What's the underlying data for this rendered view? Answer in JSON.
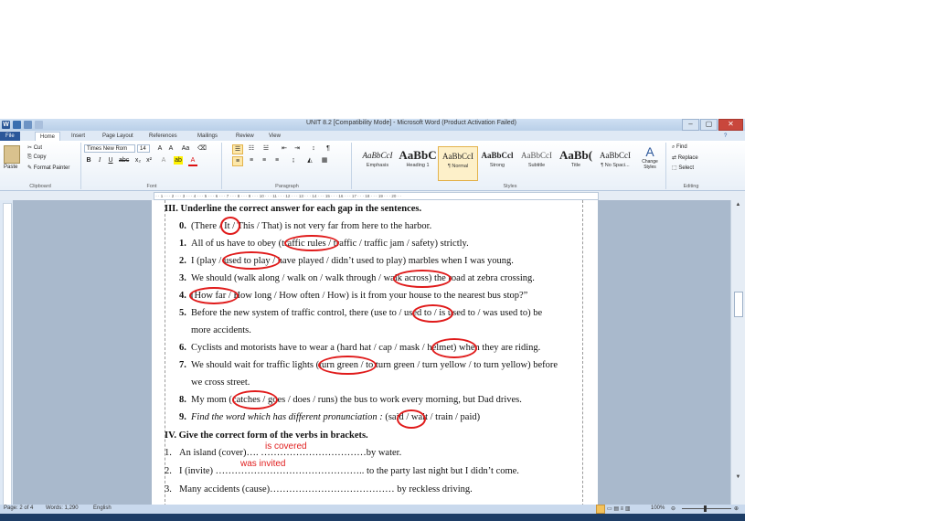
{
  "window": {
    "title": "UNIT 8.2 [Compatibility Mode] - Microsoft Word (Product Activation Failed)",
    "buttons": {
      "minimize": "–",
      "restore": "▢",
      "close": "✕"
    }
  },
  "tabs": [
    "File",
    "Home",
    "Insert",
    "Page Layout",
    "References",
    "Mailings",
    "Review",
    "View"
  ],
  "ribbon": {
    "clipboard": {
      "paste": "Paste",
      "cut": "Cut",
      "copy": "Copy",
      "format_painter": "Format Painter",
      "label": "Clipboard"
    },
    "font": {
      "name": "Times New Rom",
      "size": "14",
      "label": "Font"
    },
    "paragraph": {
      "label": "Paragraph"
    },
    "styles": {
      "label": "Styles",
      "items": [
        {
          "sample": "AaBbCcI",
          "name": "Emphasis"
        },
        {
          "sample": "AaBbC",
          "name": "Heading 1"
        },
        {
          "sample": "AaBbCcI",
          "name": "¶ Normal"
        },
        {
          "sample": "AaBbCcl",
          "name": "Strong"
        },
        {
          "sample": "AaBbCcI",
          "name": "Subtitle"
        },
        {
          "sample": "AaBb(",
          "name": "Title"
        },
        {
          "sample": "AaBbCcI",
          "name": "¶ No Spaci..."
        }
      ],
      "change_styles": "Change Styles"
    },
    "editing": {
      "find": "Find",
      "replace": "Replace",
      "select": "Select",
      "label": "Editing"
    }
  },
  "document": {
    "heading3": "III. Underline the correct answer for each gap in the sentences.",
    "items": [
      {
        "num": "0.",
        "text": "(There / It / This / That) is not very far from here to the harbor."
      },
      {
        "num": "1.",
        "text": "All of us have to obey (traffic rules / traffic / traffic jam / safety) strictly."
      },
      {
        "num": "2.",
        "text": "I (play / used to play / have played / didn’t used to play) marbles when I was young."
      },
      {
        "num": "3.",
        "text": "We should (walk along / walk on / walk through / walk across) the road at zebra crossing."
      },
      {
        "num": "4.",
        "text": "(How far / How long / How often / How) is it from your house to the nearest bus stop?”"
      },
      {
        "num": "5.",
        "text": "Before the new system of traffic control, there (use to / used to / is used to / was used to) be"
      },
      {
        "num": "",
        "text": "more accidents."
      },
      {
        "num": "6.",
        "text": "Cyclists and motorists have to wear a (hard hat / cap / mask / helmet) when they are riding."
      },
      {
        "num": "7.",
        "text": "We should wait for traffic lights (turn green / to turn green / turn yellow / to turn yellow) before"
      },
      {
        "num": "",
        "text": "we cross street."
      },
      {
        "num": "8.",
        "text": "My mom (catches / goes / does / runs) the bus to work every morning, but Dad drives."
      }
    ],
    "item9": {
      "num": "9.",
      "prompt": "Find the word which has different pronunciation :",
      "options": "(said / wait / train / paid)"
    },
    "heading4": "IV. Give the correct form of the verbs in brackets.",
    "verbs": [
      {
        "num": "1.",
        "text": "An island (cover)…. ……………………………by water."
      },
      {
        "num": "2.",
        "text": "I (invite) ……………………………………….. to the party last night but I didn’t come."
      },
      {
        "num": "3.",
        "text": "Many accidents (cause)………………………………… by reckless driving."
      }
    ],
    "answers": [
      "is covered",
      "was invited"
    ]
  },
  "status": {
    "page": "Page: 2 of 4",
    "words": "Words: 1,290",
    "language": "English",
    "zoom": "100%"
  }
}
